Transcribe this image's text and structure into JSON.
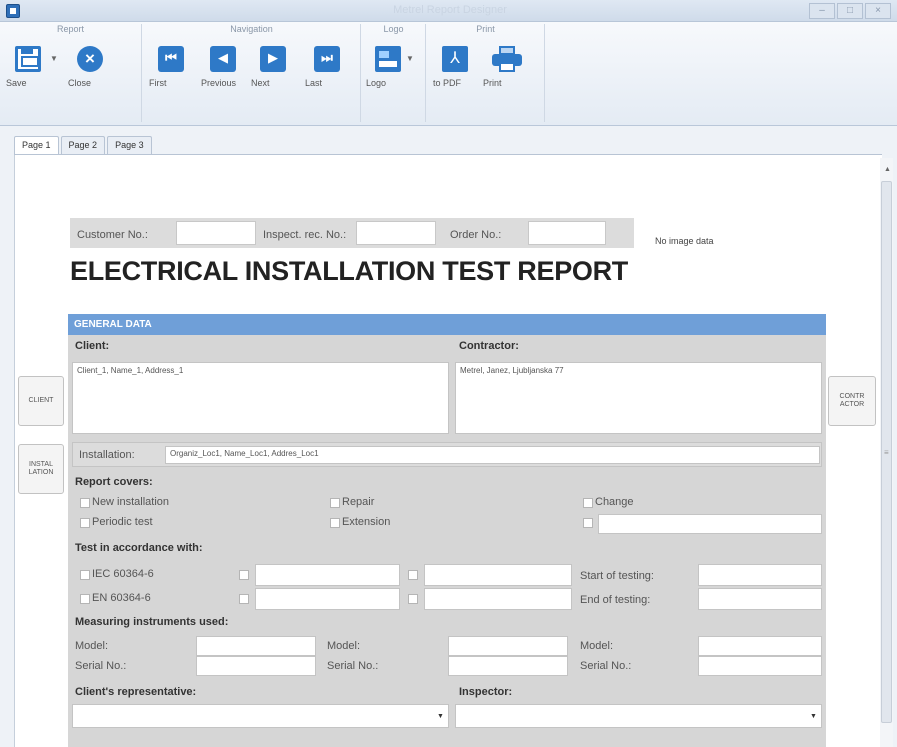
{
  "window": {
    "title": "Metrel Report Designer"
  },
  "ribbon": {
    "groups": {
      "report": "Report",
      "navigation": "Navigation",
      "logo": "Logo",
      "print": "Print"
    },
    "buttons": {
      "save": "Save",
      "close": "Close",
      "first": "First",
      "previous": "Previous",
      "next": "Next",
      "last": "Last",
      "logo": "Logo",
      "to_pdf": "to PDF",
      "print": "Print"
    }
  },
  "tabs": [
    "Page 1",
    "Page 2",
    "Page 3"
  ],
  "side_buttons": {
    "client": "CLIENT",
    "installation": "INSTAL LATION",
    "contractor": "CONTR ACTOR"
  },
  "header": {
    "customer_no_label": "Customer No.:",
    "inspect_rec_label": "Inspect. rec. No.:",
    "order_no_label": "Order No.:",
    "no_image": "No image data",
    "title": "ELECTRICAL INSTALLATION TEST REPORT"
  },
  "form": {
    "general_data": "GENERAL DATA",
    "client_label": "Client:",
    "client_value": "Client_1, Name_1, Address_1",
    "contractor_label": "Contractor:",
    "contractor_value": "Metrel, Janez, Ljubljanska 77",
    "installation_label": "Installation:",
    "installation_value": "Organiz_Loc1, Name_Loc1, Addres_Loc1",
    "report_covers": "Report covers:",
    "covers": {
      "new_installation": "New installation",
      "periodic_test": "Periodic test",
      "repair": "Repair",
      "extension": "Extension",
      "change": "Change"
    },
    "test_accordance": "Test in accordance with:",
    "standards": {
      "iec": "IEC 60364-6",
      "en": "EN 60364-6"
    },
    "start_testing": "Start of testing:",
    "end_testing": "End of testing:",
    "measuring_instruments": "Measuring instruments used:",
    "model": "Model:",
    "serial": "Serial No.:",
    "client_rep": "Client's representative:",
    "inspector": "Inspector:"
  }
}
